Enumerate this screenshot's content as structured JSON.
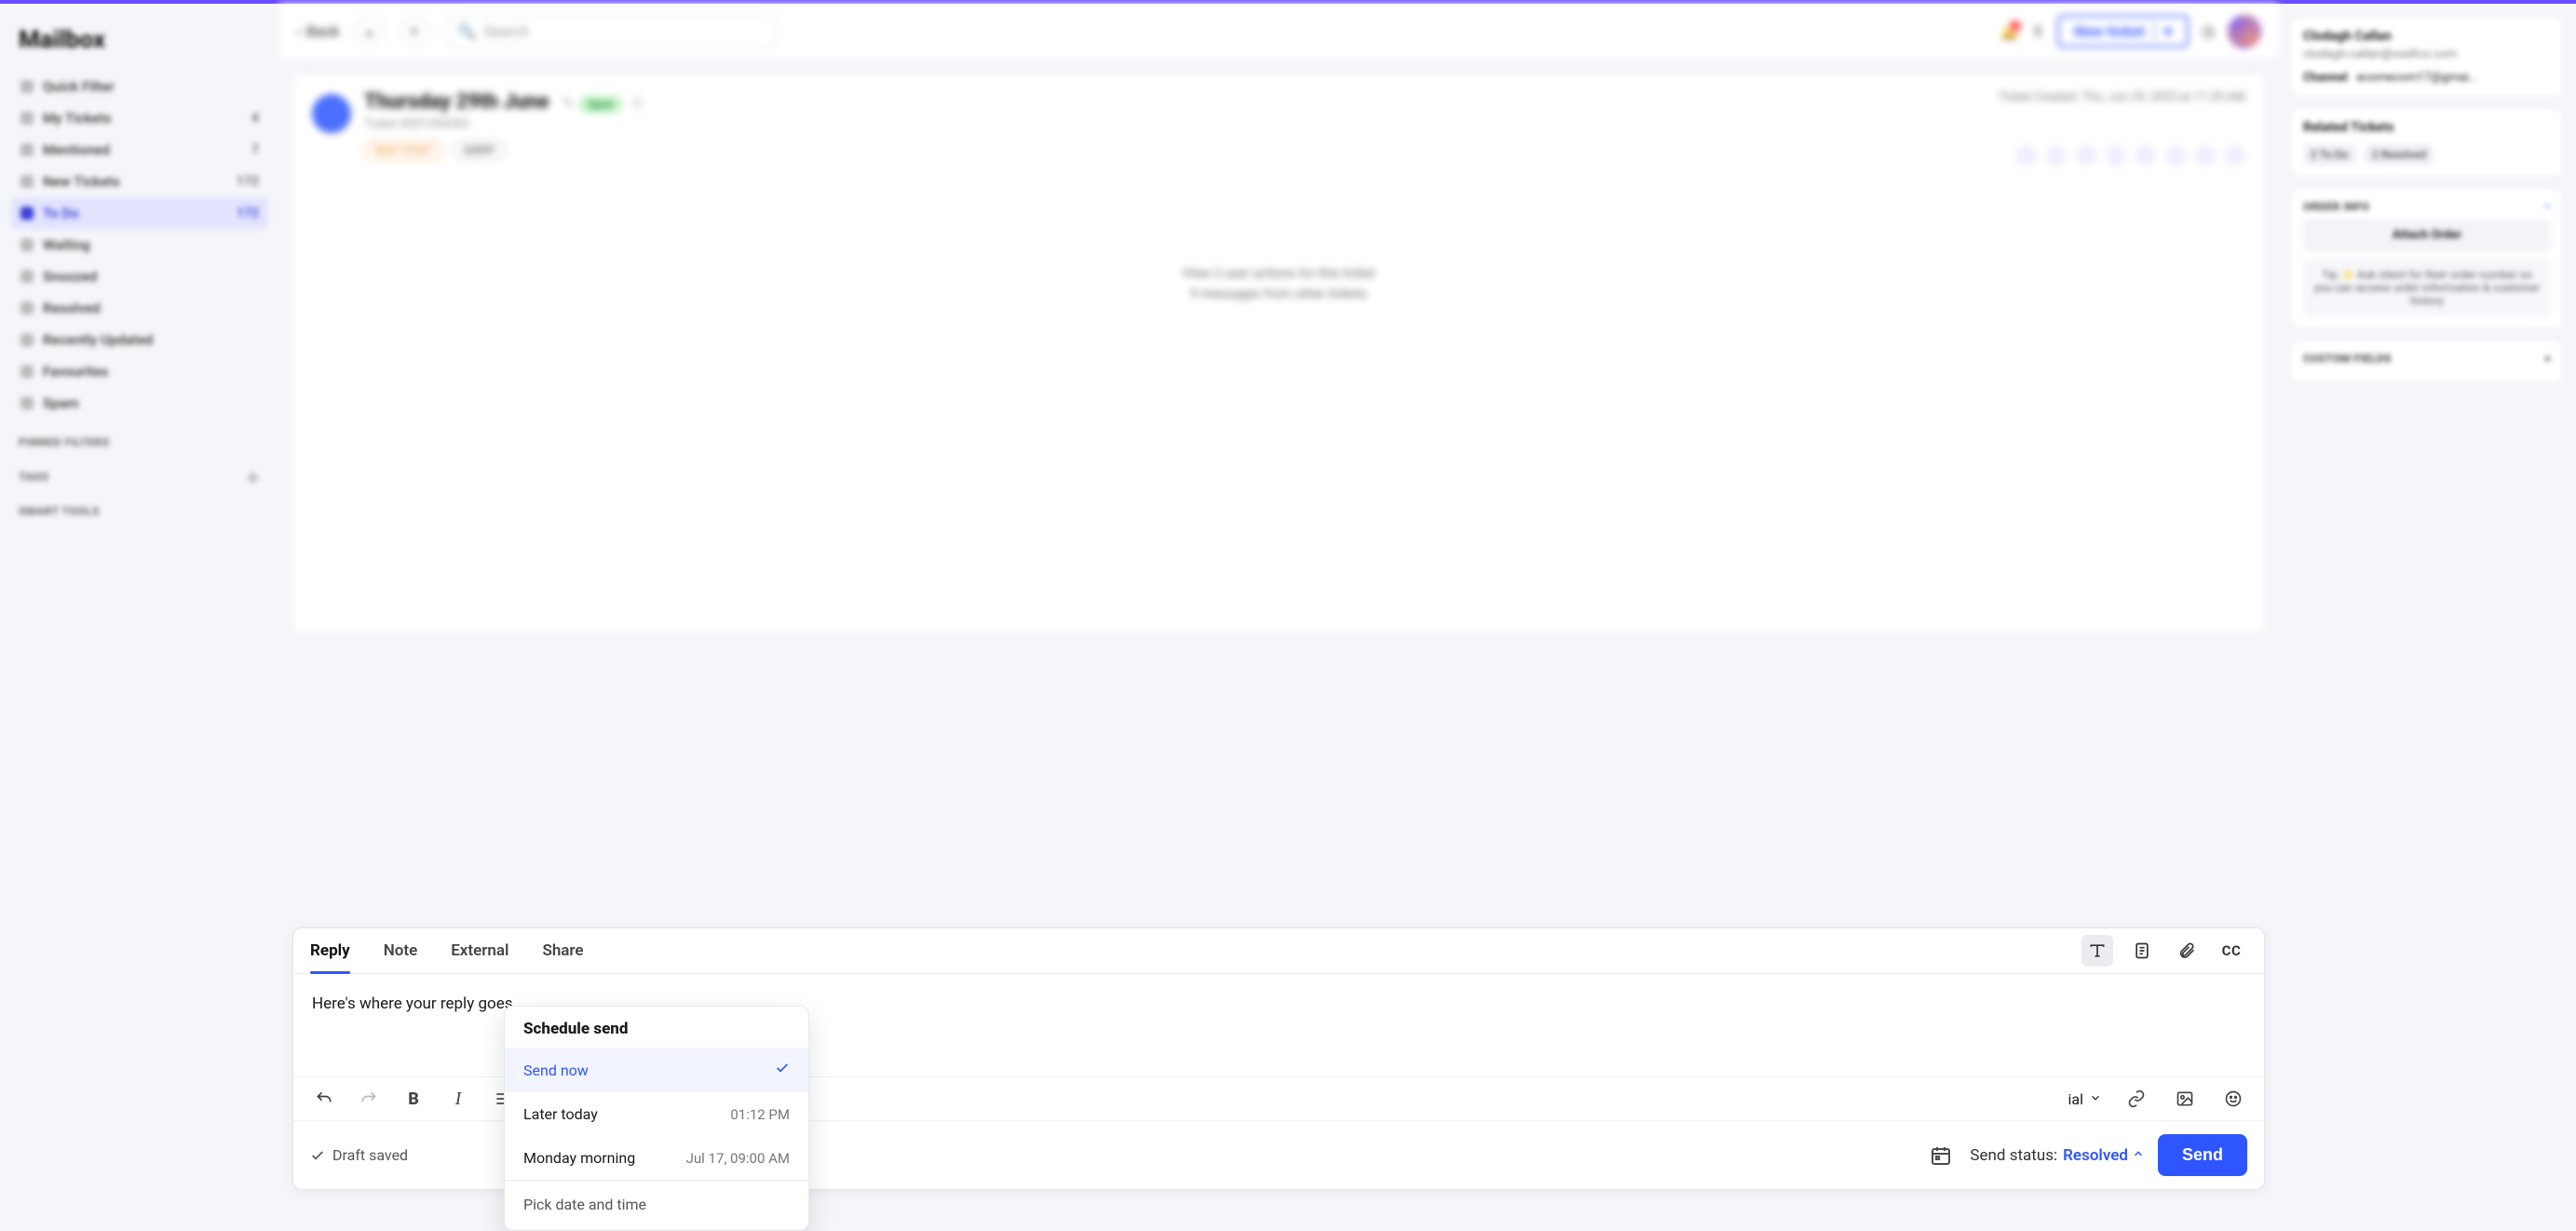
{
  "app_title": "Mailbox",
  "topbar": {
    "back": "Back",
    "search_placeholder": "Search",
    "new_ticket": "New ticket"
  },
  "sidebar": {
    "items": [
      {
        "label": "Quick Filter",
        "count": ""
      },
      {
        "label": "My Tickets",
        "count": "4"
      },
      {
        "label": "Mentioned",
        "count": "7"
      },
      {
        "label": "New Tickets",
        "count": "172"
      },
      {
        "label": "To Do",
        "count": "172",
        "active": true
      },
      {
        "label": "Waiting",
        "count": ""
      },
      {
        "label": "Snoozed",
        "count": ""
      },
      {
        "label": "Resolved",
        "count": ""
      },
      {
        "label": "Recently Updated",
        "count": ""
      },
      {
        "label": "Favourites",
        "count": ""
      },
      {
        "label": "Spam",
        "count": ""
      }
    ],
    "groups": {
      "pinned": "PINNED FILTERS",
      "tags": "TAGS",
      "smart": "SMART TOOLS"
    }
  },
  "ticket": {
    "title": "Thursday 29th June",
    "status_badge": "Open",
    "id_line": "Ticket #501394283",
    "created": "Ticket Created: Thu, Jun 29, 2023 at 11:29 AM",
    "chip_new": "NEW TICKET",
    "chip_query": "QUERY",
    "actions_line": "View 2 user actions for this ticket",
    "other_msgs": "9 messages from other tickets"
  },
  "right": {
    "customer_name": "Clodagh Callan",
    "customer_email": "clodagh.callan@xsellco.com",
    "channel_label": "Channel",
    "channel_value": "ecomecom17@gmai...",
    "related_title": "Related Tickets",
    "chip_todo": "2 To Do",
    "chip_resolved": "2 Resolved",
    "order_title": "ORDER INFO",
    "attach_label": "Attach Order",
    "tip": "Tip ✨  Ask client for their order number so you can access order information & customer history",
    "custom_title": "CUSTOM FIELDS"
  },
  "composer": {
    "tabs": {
      "reply": "Reply",
      "note": "Note",
      "external": "External",
      "share": "Share"
    },
    "cc": "CC",
    "body": "Here's where your reply goes",
    "font_name": "ial",
    "draft": "Draft saved",
    "status_label": "Send status:",
    "status_value": "Resolved",
    "send": "Send"
  },
  "schedule": {
    "title": "Schedule send",
    "now": "Send now",
    "later_label": "Later today",
    "later_time": "01:12 PM",
    "monday_label": "Monday morning",
    "monday_time": "Jul 17, 09:00 AM",
    "pick": "Pick date and time"
  }
}
